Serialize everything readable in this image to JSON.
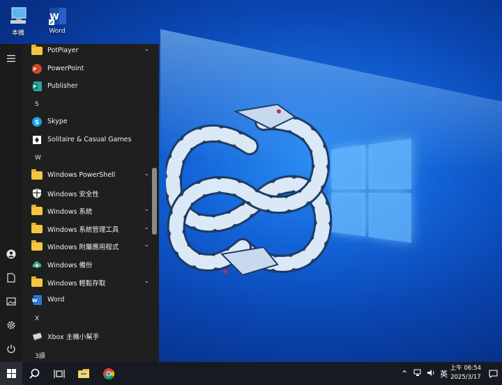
{
  "desktop": {
    "icons": [
      {
        "label": "本機",
        "icon": "computer-icon"
      },
      {
        "label": "Word",
        "icon": "word-icon"
      }
    ]
  },
  "start_menu": {
    "rail": [
      "hamburger-menu-icon",
      "user-icon",
      "document-icon",
      "pictures-icon",
      "settings-icon",
      "power-icon"
    ],
    "rows": [
      {
        "kind": "app",
        "label": "PotPlayer",
        "icon": "folder-icon",
        "expandable": true
      },
      {
        "kind": "app",
        "label": "PowerPoint",
        "icon": "powerpoint-icon",
        "expandable": false
      },
      {
        "kind": "app",
        "label": "Publisher",
        "icon": "publisher-icon",
        "expandable": false
      },
      {
        "kind": "letter",
        "label": "S"
      },
      {
        "kind": "app",
        "label": "Skype",
        "icon": "skype-icon",
        "expandable": false
      },
      {
        "kind": "app",
        "label": "Solitaire & Casual Games",
        "icon": "solitaire-icon",
        "expandable": false
      },
      {
        "kind": "letter",
        "label": "W"
      },
      {
        "kind": "app",
        "label": "Windows PowerShell",
        "icon": "folder-icon",
        "expandable": true
      },
      {
        "kind": "app",
        "label": "Windows 安全性",
        "icon": "shield-icon",
        "expandable": false
      },
      {
        "kind": "app",
        "label": "Windows 系統",
        "icon": "folder-icon",
        "expandable": true
      },
      {
        "kind": "app",
        "label": "Windows 系統管理工具",
        "icon": "folder-icon",
        "expandable": true
      },
      {
        "kind": "app",
        "label": "Windows 附屬應用程式",
        "icon": "folder-icon",
        "expandable": true
      },
      {
        "kind": "app",
        "label": "Windows 備份",
        "icon": "backup-icon",
        "expandable": false
      },
      {
        "kind": "app",
        "label": "Windows 輕鬆存取",
        "icon": "folder-icon",
        "expandable": true
      },
      {
        "kind": "app",
        "label": "Word",
        "icon": "word-icon",
        "expandable": false
      },
      {
        "kind": "letter",
        "label": "X"
      },
      {
        "kind": "app",
        "label": "Xbox 主機小幫手",
        "icon": "xbox-companion-icon",
        "expandable": false
      },
      {
        "kind": "letter",
        "label": "3讀"
      }
    ]
  },
  "taskbar": {
    "tray": {
      "language": "英",
      "time": "上午 06:54",
      "date": "2025/3/17"
    }
  },
  "colors": {
    "accent": "#0a46b2",
    "folder": "#f4c542",
    "start_bg": "#1f1f1f",
    "taskbar_bg": "#171a20"
  }
}
